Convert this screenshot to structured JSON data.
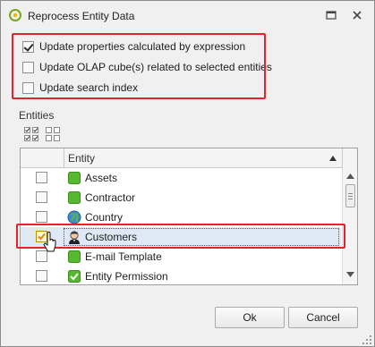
{
  "window": {
    "title": "Reprocess Entity Data",
    "app_icon": "app-logo-icon",
    "restore_icon": "restore-window-icon",
    "close_icon": "close-icon"
  },
  "options": [
    {
      "label": "Update properties calculated by expression",
      "checked": true
    },
    {
      "label": "Update OLAP cube(s) related to selected entities",
      "checked": false
    },
    {
      "label": "Update search index",
      "checked": false
    }
  ],
  "entities_section": {
    "label": "Entities",
    "select_all_icon": "select-all-icon",
    "deselect_all_icon": "deselect-all-icon"
  },
  "grid": {
    "column_header": "Entity",
    "sort": "ascending",
    "rows": [
      {
        "label": "Assets",
        "icon": "green-square-icon",
        "checked": false,
        "selected": false
      },
      {
        "label": "Contractor",
        "icon": "green-square-icon",
        "checked": false,
        "selected": false
      },
      {
        "label": "Country",
        "icon": "globe-icon",
        "checked": false,
        "selected": false
      },
      {
        "label": "Customers",
        "icon": "person-icon",
        "checked": true,
        "selected": true
      },
      {
        "label": "E-mail Template",
        "icon": "green-square-icon",
        "checked": false,
        "selected": false
      },
      {
        "label": "Entity Permission",
        "icon": "green-check-icon",
        "checked": false,
        "selected": false
      }
    ]
  },
  "buttons": {
    "ok": "Ok",
    "cancel": "Cancel"
  },
  "colors": {
    "highlight_red": "#e8222a",
    "selection_bg": "#dfe9f5",
    "entity_green": "#55b82e",
    "checkbox_orange": "#f0a000"
  }
}
